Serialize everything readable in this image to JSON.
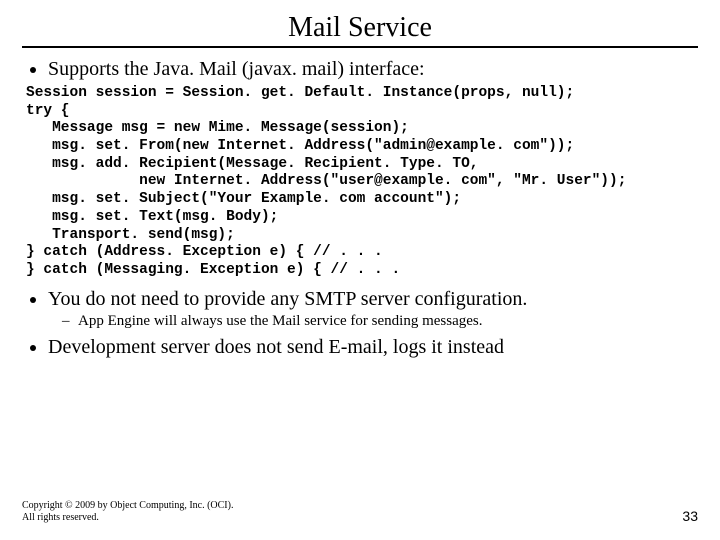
{
  "title": "Mail Service",
  "bullets": {
    "b1": "Supports the Java. Mail (javax. mail) interface:",
    "b2": "You do not need to provide any SMTP server configuration.",
    "b2_sub1": "App Engine will always use the Mail service for sending messages.",
    "b3": "Development server does not send E-mail, logs it instead"
  },
  "code": "Session session = Session. get. Default. Instance(props, null);\ntry {\n   Message msg = new Mime. Message(session);\n   msg. set. From(new Internet. Address(\"admin@example. com\"));\n   msg. add. Recipient(Message. Recipient. Type. TO,\n             new Internet. Address(\"user@example. com\", \"Mr. User\"));\n   msg. set. Subject(\"Your Example. com account\");\n   msg. set. Text(msg. Body);\n   Transport. send(msg);\n} catch (Address. Exception e) { // . . .\n} catch (Messaging. Exception e) { // . . .",
  "footer": {
    "line1": "Copyright © 2009 by Object Computing, Inc. (OCI).",
    "line2": "All rights reserved."
  },
  "page_number": "33"
}
